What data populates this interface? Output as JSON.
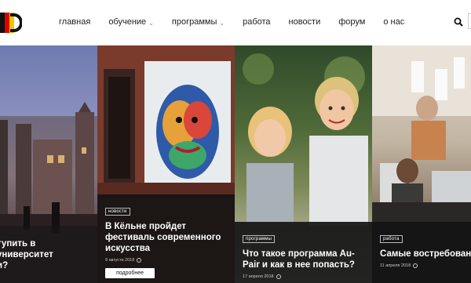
{
  "header": {
    "logo_icon": "logo-icon",
    "nav": [
      {
        "label": "главная",
        "dropdown": false
      },
      {
        "label": "обучение",
        "dropdown": true
      },
      {
        "label": "программы",
        "dropdown": true
      },
      {
        "label": "работа",
        "dropdown": false
      },
      {
        "label": "новости",
        "dropdown": false
      },
      {
        "label": "форум",
        "dropdown": false
      },
      {
        "label": "о нас",
        "dropdown": false
      }
    ],
    "search_icon": "search-icon"
  },
  "cards": [
    {
      "title": "тупить в университет\nи?"
    },
    {
      "tag": "новости",
      "title": "В Кёльне пройдет фестиваль современного искусства",
      "date": "9 августа 2018",
      "button": "подробнее"
    },
    {
      "tag": "программы",
      "title": "Что такое программа Au-Pair и как в нее попасть?",
      "date": "17 апреля 2018"
    },
    {
      "tag": "работа",
      "title": "Самые востребованные профессии Германии",
      "date": "11 апреля 2018"
    }
  ],
  "colors": {
    "header_bg": "#ffffff",
    "nav_text": "#222222",
    "overlay": "#141414",
    "title_text": "#ffffff"
  }
}
